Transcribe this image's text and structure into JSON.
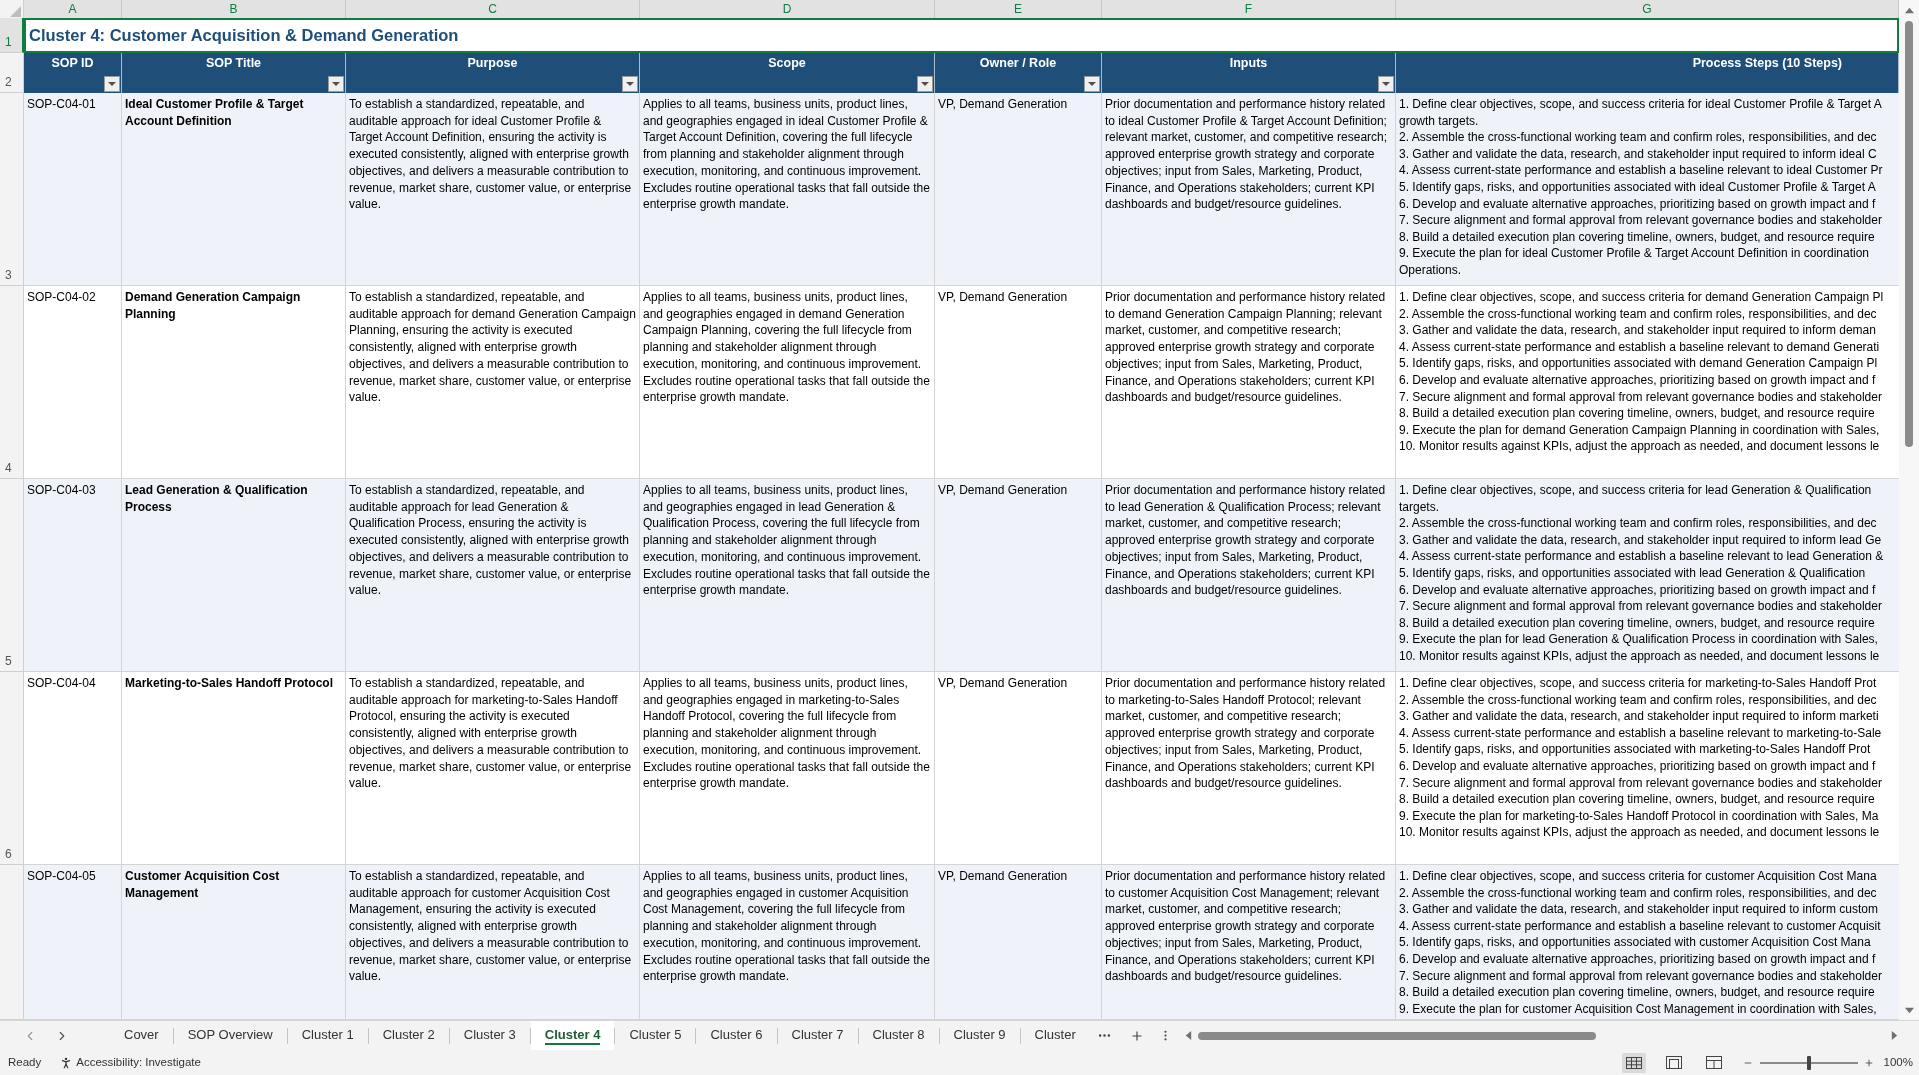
{
  "column_headers": [
    {
      "label": "A",
      "selected": true
    },
    {
      "label": "B",
      "selected": true
    },
    {
      "label": "C",
      "selected": true
    },
    {
      "label": "D",
      "selected": true
    },
    {
      "label": "E",
      "selected": true
    },
    {
      "label": "F",
      "selected": true
    },
    {
      "label": "G",
      "selected": true
    }
  ],
  "row_headers": [
    {
      "label": "1",
      "selected": true
    },
    {
      "label": "2",
      "selected": false
    },
    {
      "label": "3",
      "selected": false
    },
    {
      "label": "4",
      "selected": false
    },
    {
      "label": "5",
      "selected": false
    },
    {
      "label": "6",
      "selected": false
    }
  ],
  "title_row": {
    "title": "Cluster 4: Customer Acquisition & Demand Generation",
    "selected": true
  },
  "table": {
    "columns": [
      {
        "label": "SOP ID",
        "filter": true
      },
      {
        "label": "SOP Title",
        "filter": true
      },
      {
        "label": "Purpose",
        "filter": true
      },
      {
        "label": "Scope",
        "filter": true
      },
      {
        "label": "Owner / Role",
        "filter": true
      },
      {
        "label": "Inputs",
        "filter": true
      },
      {
        "label": "Process Steps (10 Steps)",
        "filter": false
      }
    ],
    "rows": [
      {
        "sop_id": "SOP-C04-01",
        "sop_title": "Ideal Customer Profile & Target Account Definition",
        "purpose": "To establish a standardized, repeatable, and auditable approach for ideal Customer Profile & Target Account Definition, ensuring the activity is executed consistently, aligned with enterprise growth objectives, and delivers a measurable contribution to revenue, market share, customer value, or enterprise value.",
        "scope": "Applies to all teams, business units, product lines, and geographies engaged in ideal Customer Profile & Target Account Definition, covering the full lifecycle from planning and stakeholder alignment through execution, monitoring, and continuous improvement. Excludes routine operational tasks that fall outside the enterprise growth mandate.",
        "owner_role": "VP, Demand Generation",
        "inputs": "Prior documentation and performance history related to ideal Customer Profile & Target Account Definition; relevant market, customer, and competitive research; approved enterprise growth strategy and corporate objectives; input from Sales, Marketing, Product, Finance, and Operations stakeholders; current KPI dashboards and budget/resource guidelines.",
        "process_steps": [
          "1. Define clear objectives, scope, and success criteria for ideal Customer Profile & Target A",
          "growth targets.",
          "2. Assemble the cross-functional working team and confirm roles, responsibilities, and dec",
          "3. Gather and validate the data, research, and stakeholder input required to inform ideal C",
          "4. Assess current-state performance and establish a baseline relevant to ideal Customer Pr",
          "5. Identify gaps, risks, and opportunities associated with ideal Customer Profile & Target A",
          "6. Develop and evaluate alternative approaches, prioritizing based on growth impact and f",
          "7. Secure alignment and formal approval from relevant governance bodies and stakeholder",
          "8. Build a detailed execution plan covering timeline, owners, budget, and resource require",
          "9. Execute the plan for ideal Customer Profile & Target Account Definition in coordination",
          "Operations."
        ]
      },
      {
        "sop_id": "SOP-C04-02",
        "sop_title": "Demand Generation Campaign Planning",
        "purpose": "To establish a standardized, repeatable, and auditable approach for demand Generation Campaign Planning, ensuring the activity is executed consistently, aligned with enterprise growth objectives, and delivers a measurable contribution to revenue, market share, customer value, or enterprise value.",
        "scope": "Applies to all teams, business units, product lines, and geographies engaged in demand Generation Campaign Planning, covering the full lifecycle from planning and stakeholder alignment through execution, monitoring, and continuous improvement. Excludes routine operational tasks that fall outside the enterprise growth mandate.",
        "owner_role": "VP, Demand Generation",
        "inputs": "Prior documentation and performance history related to demand Generation Campaign Planning; relevant market, customer, and competitive research; approved enterprise growth strategy and corporate objectives; input from Sales, Marketing, Product, Finance, and Operations stakeholders; current KPI dashboards and budget/resource guidelines.",
        "process_steps": [
          "1. Define clear objectives, scope, and success criteria for demand Generation Campaign Pl",
          "2. Assemble the cross-functional working team and confirm roles, responsibilities, and dec",
          "3. Gather and validate the data, research, and stakeholder input required to inform deman",
          "4. Assess current-state performance and establish a baseline relevant to demand Generati",
          "5. Identify gaps, risks, and opportunities associated with demand Generation Campaign Pl",
          "6. Develop and evaluate alternative approaches, prioritizing based on growth impact and f",
          "7. Secure alignment and formal approval from relevant governance bodies and stakeholder",
          "8. Build a detailed execution plan covering timeline, owners, budget, and resource require",
          "9. Execute the plan for demand Generation Campaign Planning in coordination with Sales,",
          "10. Monitor results against KPIs, adjust the approach as needed, and document lessons le"
        ]
      },
      {
        "sop_id": "SOP-C04-03",
        "sop_title": "Lead Generation & Qualification Process",
        "purpose": "To establish a standardized, repeatable, and auditable approach for lead Generation & Qualification Process, ensuring the activity is executed consistently, aligned with enterprise growth objectives, and delivers a measurable contribution to revenue, market share, customer value, or enterprise value.",
        "scope": "Applies to all teams, business units, product lines, and geographies engaged in lead Generation & Qualification Process, covering the full lifecycle from planning and stakeholder alignment through execution, monitoring, and continuous improvement. Excludes routine operational tasks that fall outside the enterprise growth mandate.",
        "owner_role": "VP, Demand Generation",
        "inputs": "Prior documentation and performance history related to lead Generation & Qualification Process; relevant market, customer, and competitive research; approved enterprise growth strategy and corporate objectives; input from Sales, Marketing, Product, Finance, and Operations stakeholders; current KPI dashboards and budget/resource guidelines.",
        "process_steps": [
          "1. Define clear objectives, scope, and success criteria for lead Generation & Qualification",
          "targets.",
          "2. Assemble the cross-functional working team and confirm roles, responsibilities, and dec",
          "3. Gather and validate the data, research, and stakeholder input required to inform lead Ge",
          "4. Assess current-state performance and establish a baseline relevant to lead Generation &",
          "5. Identify gaps, risks, and opportunities associated with lead Generation & Qualification",
          "6. Develop and evaluate alternative approaches, prioritizing based on growth impact and f",
          "7. Secure alignment and formal approval from relevant governance bodies and stakeholder",
          "8. Build a detailed execution plan covering timeline, owners, budget, and resource require",
          "9. Execute the plan for lead Generation & Qualification Process in coordination with Sales,",
          "10. Monitor results against KPIs, adjust the approach as needed, and document lessons le"
        ]
      },
      {
        "sop_id": "SOP-C04-04",
        "sop_title": "Marketing-to-Sales Handoff Protocol",
        "purpose": "To establish a standardized, repeatable, and auditable approach for marketing-to-Sales Handoff Protocol, ensuring the activity is executed consistently, aligned with enterprise growth objectives, and delivers a measurable contribution to revenue, market share, customer value, or enterprise value.",
        "scope": "Applies to all teams, business units, product lines, and geographies engaged in marketing-to-Sales Handoff Protocol, covering the full lifecycle from planning and stakeholder alignment through execution, monitoring, and continuous improvement. Excludes routine operational tasks that fall outside the enterprise growth mandate.",
        "owner_role": "VP, Demand Generation",
        "inputs": "Prior documentation and performance history related to marketing-to-Sales Handoff Protocol; relevant market, customer, and competitive research; approved enterprise growth strategy and corporate objectives; input from Sales, Marketing, Product, Finance, and Operations stakeholders; current KPI dashboards and budget/resource guidelines.",
        "process_steps": [
          "1. Define clear objectives, scope, and success criteria for marketing-to-Sales Handoff Prot",
          "2. Assemble the cross-functional working team and confirm roles, responsibilities, and dec",
          "3. Gather and validate the data, research, and stakeholder input required to inform marketi",
          "4. Assess current-state performance and establish a baseline relevant to marketing-to-Sale",
          "5. Identify gaps, risks, and opportunities associated with marketing-to-Sales Handoff Prot",
          "6. Develop and evaluate alternative approaches, prioritizing based on growth impact and f",
          "7. Secure alignment and formal approval from relevant governance bodies and stakeholder",
          "8. Build a detailed execution plan covering timeline, owners, budget, and resource require",
          "9. Execute the plan for marketing-to-Sales Handoff Protocol in coordination with Sales, Ma",
          "10. Monitor results against KPIs, adjust the approach as needed, and document lessons le"
        ]
      },
      {
        "sop_id": "SOP-C04-05",
        "sop_title": "Customer Acquisition Cost Management",
        "purpose": "To establish a standardized, repeatable, and auditable approach for customer Acquisition Cost Management, ensuring the activity is executed consistently, aligned with enterprise growth objectives, and delivers a measurable contribution to revenue, market share, customer value, or enterprise value.",
        "scope": "Applies to all teams, business units, product lines, and geographies engaged in customer Acquisition Cost Management, covering the full lifecycle from planning and stakeholder alignment through execution, monitoring, and continuous improvement. Excludes routine operational tasks that fall outside the enterprise growth mandate.",
        "owner_role": "VP, Demand Generation",
        "inputs": "Prior documentation and performance history related to customer Acquisition Cost Management; relevant market, customer, and competitive research; approved enterprise growth strategy and corporate objectives; input from Sales, Marketing, Product, Finance, and Operations stakeholders; current KPI dashboards and budget/resource guidelines.",
        "process_steps": [
          "1. Define clear objectives, scope, and success criteria for customer Acquisition Cost Mana",
          "2. Assemble the cross-functional working team and confirm roles, responsibilities, and dec",
          "3. Gather and validate the data, research, and stakeholder input required to inform custom",
          "4. Assess current-state performance and establish a baseline relevant to customer Acquisit",
          "5. Identify gaps, risks, and opportunities associated with customer Acquisition Cost Mana",
          "6. Develop and evaluate alternative approaches, prioritizing based on growth impact and f",
          "7. Secure alignment and formal approval from relevant governance bodies and stakeholder",
          "8. Build a detailed execution plan covering timeline, owners, budget, and resource require",
          "9. Execute the plan for customer Acquisition Cost Management in coordination with Sales,"
        ]
      }
    ]
  },
  "sheet_tabs": [
    {
      "label": "Cover",
      "selected": false
    },
    {
      "label": "SOP Overview",
      "selected": false
    },
    {
      "label": "Cluster 1",
      "selected": false
    },
    {
      "label": "Cluster 2",
      "selected": false
    },
    {
      "label": "Cluster 3",
      "selected": false
    },
    {
      "label": "Cluster 4",
      "selected": true
    },
    {
      "label": "Cluster 5",
      "selected": false
    },
    {
      "label": "Cluster 6",
      "selected": false
    },
    {
      "label": "Cluster 7",
      "selected": false
    },
    {
      "label": "Cluster 8",
      "selected": false
    },
    {
      "label": "Cluster 9",
      "selected": false
    },
    {
      "label": "Cluster",
      "selected": false
    }
  ],
  "status_bar": {
    "status": "Ready",
    "accessibility": "Accessibility: Investigate",
    "views": [
      {
        "kind": "normal",
        "selected": true
      },
      {
        "kind": "page_layout",
        "selected": false
      },
      {
        "kind": "page_break",
        "selected": false
      }
    ],
    "zoom": {
      "level": 0.5,
      "reading": "100%"
    }
  }
}
